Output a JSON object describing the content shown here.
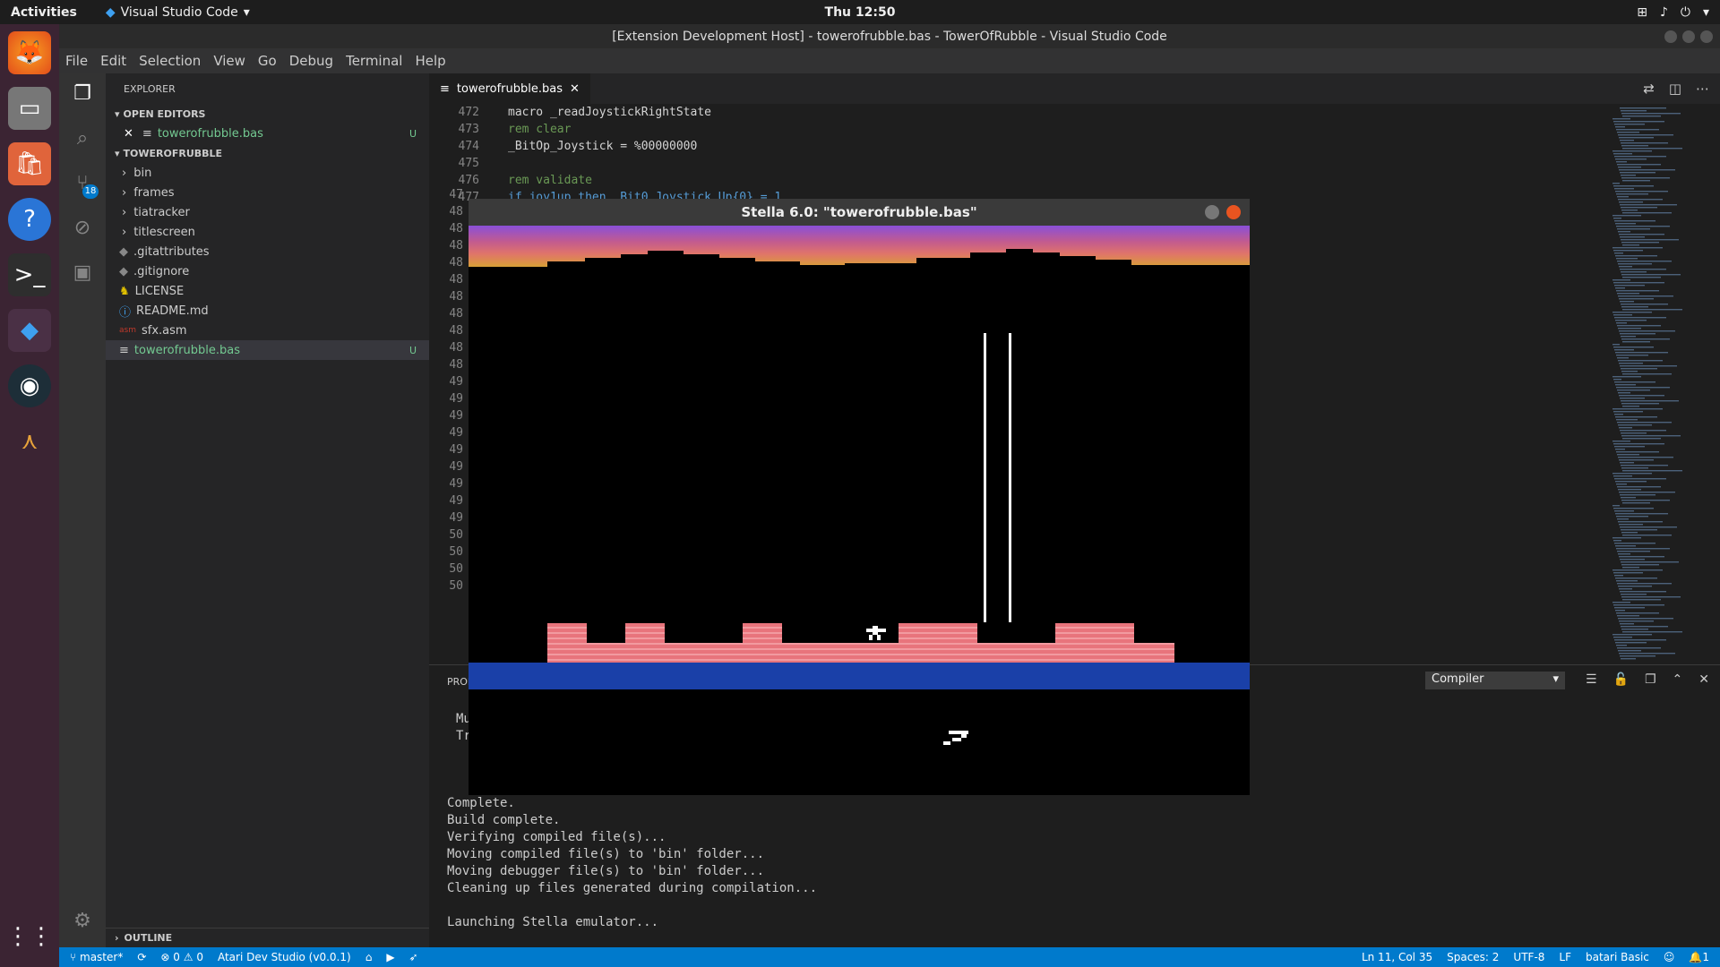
{
  "topbar": {
    "activities": "Activities",
    "app": "Visual Studio Code",
    "clock": "Thu 12:50"
  },
  "window": {
    "title": "[Extension Development Host] - towerofrubble.bas - TowerOfRubble - Visual Studio Code"
  },
  "menu": [
    "File",
    "Edit",
    "Selection",
    "View",
    "Go",
    "Debug",
    "Terminal",
    "Help"
  ],
  "activity": {
    "scm_badge": "18"
  },
  "sidebar": {
    "title": "EXPLORER",
    "open_editors": "OPEN EDITORS",
    "open_file": "towerofrubble.bas",
    "open_file_status": "U",
    "project": "TOWEROFRUBBLE",
    "folders": [
      "bin",
      "frames",
      "tiatracker",
      "titlescreen"
    ],
    "files": [
      ".gitattributes",
      ".gitignore",
      "LICENSE",
      "README.md",
      "sfx.asm",
      "towerofrubble.bas"
    ],
    "selected_status": "U",
    "outline": "OUTLINE"
  },
  "editor": {
    "tab": "towerofrubble.bas",
    "lines": [
      {
        "n": "472",
        "t": "macro _readJoystickRightState"
      },
      {
        "n": "473",
        "t": "rem clear"
      },
      {
        "n": "474",
        "t": "_BitOp_Joystick = %00000000"
      },
      {
        "n": "475",
        "t": ""
      },
      {
        "n": "476",
        "t": "rem validate"
      },
      {
        "n": "477",
        "t": "if joy1up then  Bit0 Joystick Up{0} = 1"
      }
    ],
    "hidden_line_prefixes": [
      "47",
      "48",
      "48",
      "48",
      "48",
      "48",
      "48",
      "48",
      "48",
      "48",
      "48",
      "49",
      "49",
      "49",
      "49",
      "49",
      "49",
      "49",
      "49",
      "49",
      "50",
      "50",
      "50",
      "50"
    ]
  },
  "stella": {
    "title": "Stella 6.0: \"towerofrubble.bas\""
  },
  "panel": {
    "tab_partial": "PROI",
    "dropdown": "Compiler",
    "cut_lines": [
      "Mu",
      "Tr"
    ],
    "output": [
      "Complete.",
      "Build complete.",
      "Verifying compiled file(s)...",
      "Moving compiled file(s) to 'bin' folder...",
      "Moving debugger file(s) to 'bin' folder...",
      "Cleaning up files generated during compilation...",
      "",
      "Launching Stella emulator..."
    ]
  },
  "status": {
    "branch": "master*",
    "errors": "0",
    "warnings": "0",
    "extension": "Atari Dev Studio (v0.0.1)",
    "position": "Ln 11, Col 35",
    "spaces": "Spaces: 2",
    "encoding": "UTF-8",
    "eol": "LF",
    "language": "batari Basic",
    "notifications": "1"
  },
  "colors": {
    "accent": "#007acc",
    "dock": "#3b2433",
    "brick": "#e8747c",
    "water": "#1a40a8"
  }
}
